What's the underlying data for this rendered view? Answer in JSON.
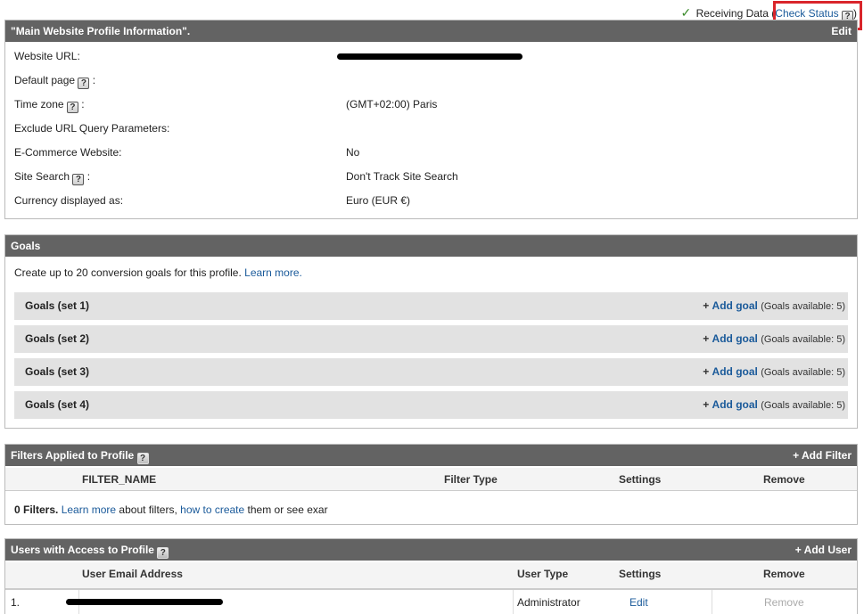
{
  "status": {
    "receiving_text": "Receiving Data (",
    "check_status_link": "Check Status",
    "close_paren": ")"
  },
  "profile": {
    "title": "\"Main Website Profile Information\".",
    "edit_label": "Edit",
    "rows": [
      {
        "label": "Website URL:",
        "value": ""
      },
      {
        "label": "Default page",
        "value": ""
      },
      {
        "label": "Time zone",
        "value": "(GMT+02:00) Paris"
      },
      {
        "label": "Exclude URL Query Parameters:",
        "value": ""
      },
      {
        "label": "E-Commerce Website:",
        "value": "No"
      },
      {
        "label": "Site Search",
        "value": "Don't Track Site Search"
      },
      {
        "label": "Currency displayed as:",
        "value": "Euro (EUR €)"
      }
    ],
    "colon": ":"
  },
  "goals": {
    "title": "Goals",
    "intro": "Create up to 20 conversion goals for this profile.",
    "learn_more": "Learn more.",
    "sets": [
      {
        "name": "Goals (set 1)",
        "add": "Add goal",
        "avail": "(Goals available: 5)"
      },
      {
        "name": "Goals (set 2)",
        "add": "Add goal",
        "avail": "(Goals available: 5)"
      },
      {
        "name": "Goals (set 3)",
        "add": "Add goal",
        "avail": "(Goals available: 5)"
      },
      {
        "name": "Goals (set 4)",
        "add": "Add goal",
        "avail": "(Goals available: 5)"
      }
    ]
  },
  "filters": {
    "title": "Filters Applied to Profile",
    "add_label": "Add Filter",
    "columns": [
      "FILTER_NAME",
      "Filter Type",
      "Settings",
      "Remove"
    ],
    "count_text": "0 Filters.",
    "learn_more": "Learn more",
    "about_text": "about filters,",
    "how_to_create": "how to create",
    "tail_text": "them or see exar"
  },
  "users": {
    "title": "Users with Access to Profile",
    "add_label": "Add User",
    "columns": [
      "User Email Address",
      "User Type",
      "Settings",
      "Remove"
    ],
    "rows": [
      {
        "index": "1.",
        "email": "",
        "type": "Administrator",
        "settings": "Edit",
        "remove": "Remove"
      }
    ]
  },
  "icons": {
    "help": "question-mark-icon",
    "check": "checkmark-icon",
    "plus": "plus-icon"
  },
  "colors": {
    "header_bg": "#636363",
    "link": "#1a5a9a",
    "highlight": "#d9252b",
    "goal_row_bg": "#e2e2e2"
  }
}
